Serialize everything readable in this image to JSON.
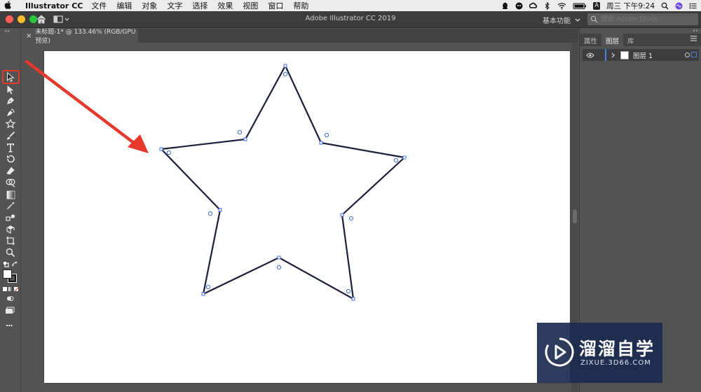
{
  "menubar": {
    "app_name": "Illustrator CC",
    "items": [
      "文件",
      "编辑",
      "对象",
      "文字",
      "选择",
      "效果",
      "视图",
      "窗口",
      "帮助"
    ],
    "clock": "周三 下午9:24",
    "input_badge": "A"
  },
  "titlebar": {
    "title": "Adobe Illustrator CC 2019",
    "workspace_label": "基本功能",
    "stock_placeholder": "搜索 Adobe Stock"
  },
  "document": {
    "tab_label": "未标题-1* @ 133.46% (RGB/GPU 预览)",
    "close_glyph": "×"
  },
  "panel": {
    "tabs": [
      "属性",
      "图层",
      "库"
    ],
    "active_tab": "图层",
    "layer_name": "图层 1"
  },
  "watermark": {
    "name": "溜溜自学",
    "url": "ZIXUE.3D66.COM"
  },
  "toolbar_more": "...",
  "colors": {
    "accent": "#4a7fd6",
    "annotation": "#e5392b",
    "star_stroke": "#1b1f3a",
    "anchor": "#3f6fe0"
  },
  "tools": [
    "selection-tool-icon",
    "direct-selection-tool-icon",
    "pen-tool-icon",
    "curvature-tool-icon",
    "star-tool-icon",
    "paintbrush-tool-icon",
    "type-tool-icon",
    "rotate-tool-icon",
    "eraser-tool-icon",
    "gradient-tool-icon",
    "eyedropper-tool-icon",
    "blend-tool-icon",
    "live-paint-tool-icon",
    "artboard-tool-icon",
    "zoom-tool-icon"
  ]
}
